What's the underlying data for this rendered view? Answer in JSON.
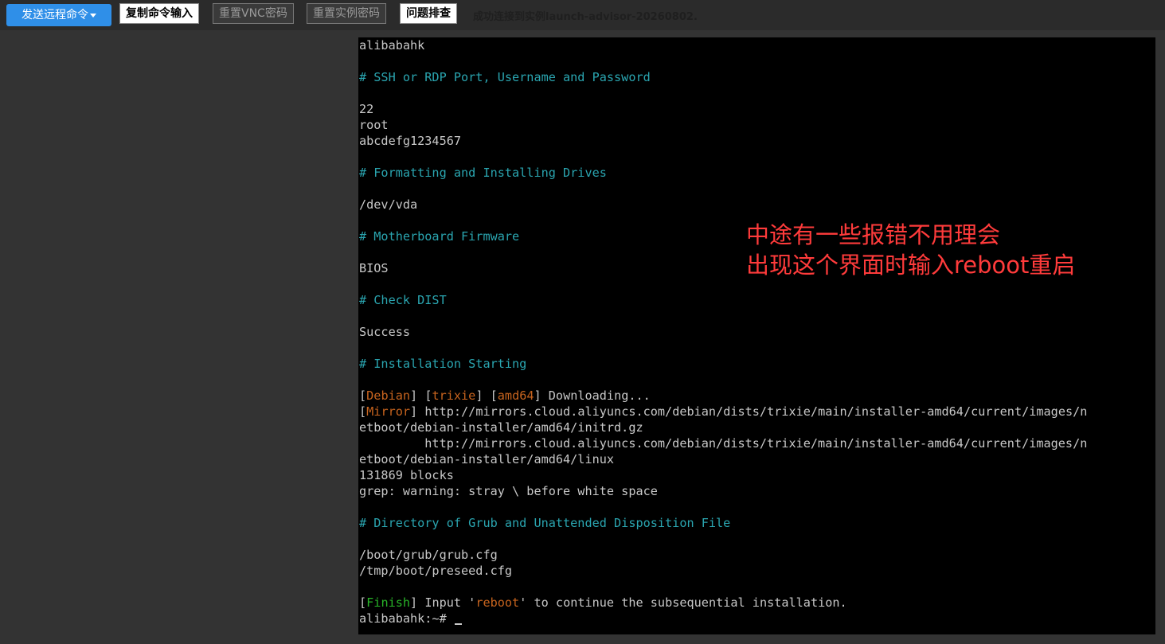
{
  "toolbar": {
    "send_remote_command": "发送远程命令",
    "copy_command_input": "复制命令输入",
    "reset_vnc_password": "重置VNC密码",
    "reset_instance_password": "重置实例密码",
    "troubleshoot": "问题排查",
    "status": "成功连接到实例launch-advisor-20260802."
  },
  "terminal": {
    "lines": [
      [
        {
          "t": "alibabahk",
          "c": "grey"
        }
      ],
      [],
      [
        {
          "t": "# SSH or RDP Port, Username and Password",
          "c": "cyan"
        }
      ],
      [],
      [
        {
          "t": "22",
          "c": "grey"
        }
      ],
      [
        {
          "t": "root",
          "c": "grey"
        }
      ],
      [
        {
          "t": "abcdefg1234567",
          "c": "grey"
        }
      ],
      [],
      [
        {
          "t": "# Formatting and Installing Drives",
          "c": "cyan"
        }
      ],
      [],
      [
        {
          "t": "/dev/vda",
          "c": "grey"
        }
      ],
      [],
      [
        {
          "t": "# Motherboard Firmware",
          "c": "cyan"
        }
      ],
      [],
      [
        {
          "t": "BIOS",
          "c": "grey"
        }
      ],
      [],
      [
        {
          "t": "# Check DIST",
          "c": "cyan"
        }
      ],
      [],
      [
        {
          "t": "Success",
          "c": "grey"
        }
      ],
      [],
      [
        {
          "t": "# Installation Starting",
          "c": "cyan"
        }
      ],
      [],
      [
        {
          "t": "[",
          "c": "grey"
        },
        {
          "t": "Debian",
          "c": "orange"
        },
        {
          "t": "] [",
          "c": "grey"
        },
        {
          "t": "trixie",
          "c": "orange"
        },
        {
          "t": "] [",
          "c": "grey"
        },
        {
          "t": "amd64",
          "c": "orange"
        },
        {
          "t": "] Downloading...",
          "c": "grey"
        }
      ],
      [
        {
          "t": "[",
          "c": "grey"
        },
        {
          "t": "Mirror",
          "c": "orange"
        },
        {
          "t": "] http://mirrors.cloud.aliyuncs.com/debian/dists/trixie/main/installer-amd64/current/images/n",
          "c": "grey"
        }
      ],
      [
        {
          "t": "etboot/debian-installer/amd64/initrd.gz",
          "c": "grey"
        }
      ],
      [
        {
          "t": "         http://mirrors.cloud.aliyuncs.com/debian/dists/trixie/main/installer-amd64/current/images/n",
          "c": "grey"
        }
      ],
      [
        {
          "t": "etboot/debian-installer/amd64/linux",
          "c": "grey"
        }
      ],
      [
        {
          "t": "131869 blocks",
          "c": "grey"
        }
      ],
      [
        {
          "t": "grep: warning: stray \\ before white space",
          "c": "grey"
        }
      ],
      [],
      [
        {
          "t": "# Directory of Grub and Unattended Disposition File",
          "c": "cyan"
        }
      ],
      [],
      [
        {
          "t": "/boot/grub/grub.cfg",
          "c": "grey"
        }
      ],
      [
        {
          "t": "/tmp/boot/preseed.cfg",
          "c": "grey"
        }
      ],
      [],
      [
        {
          "t": "[",
          "c": "grey"
        },
        {
          "t": "Finish",
          "c": "green"
        },
        {
          "t": "] Input '",
          "c": "grey"
        },
        {
          "t": "reboot",
          "c": "orange"
        },
        {
          "t": "' to continue the subsequential installation.",
          "c": "grey"
        }
      ],
      [
        {
          "t": "alibabahk:~# ",
          "c": "grey"
        }
      ]
    ]
  },
  "annotation": {
    "line1": "中途有一些报错不用理会",
    "line2": "出现这个界面时输入reboot重启"
  },
  "colors": {
    "page_background": "#333333",
    "terminal_background": "#000000",
    "primary_button": "#2f8fe8",
    "terminal_text": "#c8c8c8",
    "terminal_heading": "#2aa5b0",
    "terminal_tag": "#c8641e",
    "terminal_finish": "#28b428",
    "annotation_text": "#ff3b3b"
  }
}
